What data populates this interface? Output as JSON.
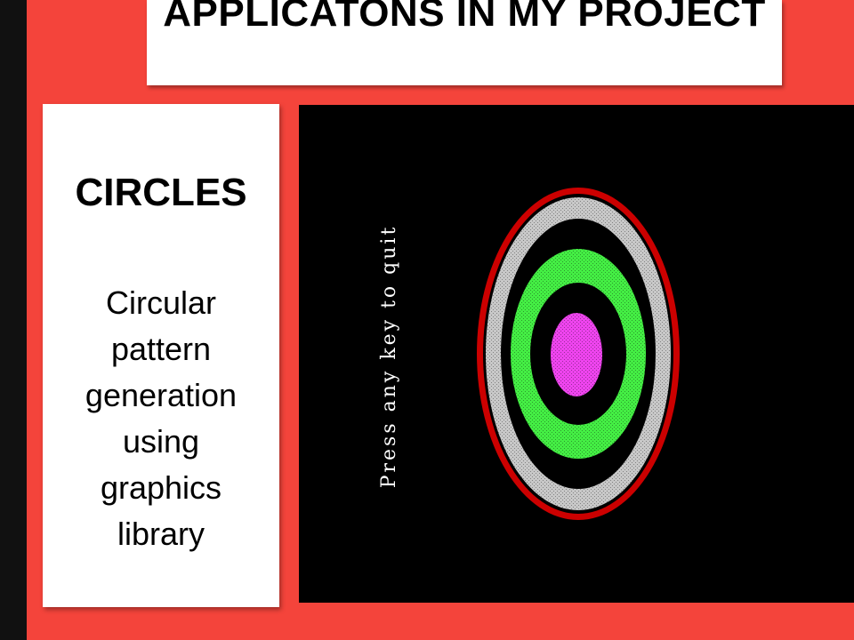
{
  "slide": {
    "title": "APPLICATONS IN MY PROJECT",
    "background_color": "#f4443b"
  },
  "card": {
    "heading": "CIRCLES",
    "body_lines": [
      "Circular",
      "pattern",
      "generation",
      "using",
      "graphics",
      "library"
    ]
  },
  "screen": {
    "prompt": "Press any key to quit",
    "prompt_color": "#ffffff",
    "rings": [
      {
        "name": "outer-red-ring",
        "color": "#cc0000"
      },
      {
        "name": "gray-ring",
        "color": "#c8c8c8"
      },
      {
        "name": "green-ring",
        "color": "#44ee44"
      },
      {
        "name": "magenta-center",
        "color": "#ee44ee"
      }
    ]
  }
}
